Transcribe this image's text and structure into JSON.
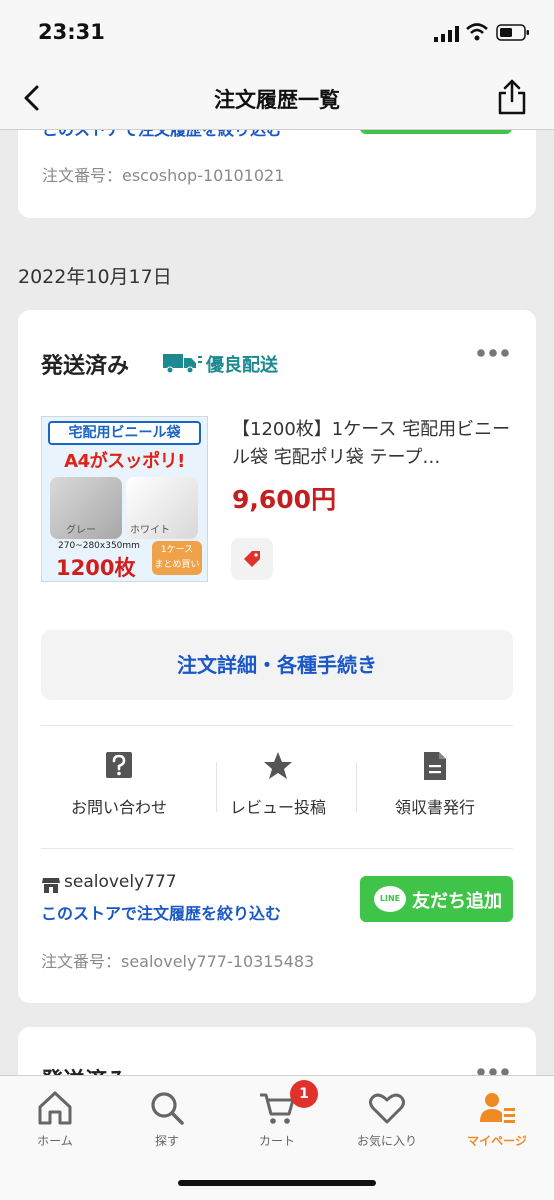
{
  "status_bar": {
    "time": "23:31"
  },
  "nav": {
    "title": "注文履歴一覧",
    "back_icon": "chevron-left-icon",
    "share_icon": "share-icon"
  },
  "prev_order": {
    "store_filter_partial": "このストアで注文履歴を絞り込む",
    "order_number": "注文番号：escoshop-10101021"
  },
  "date_header": "2022年10月17日",
  "order": {
    "status": "発送済み",
    "badge": "優良配送",
    "item": {
      "thumb_title": "宅配用ビニール袋",
      "thumb_sub": "A4がスッポリ!",
      "thumb_grey": "グレー",
      "thumb_white": "ホワイト",
      "thumb_size": "270~280x350mm",
      "thumb_count": "1200枚",
      "thumb_badge_1": "1ケース",
      "thumb_badge_2": "まとめ買い",
      "name": "【1200枚】1ケース 宅配用ビニール袋 宅配ポリ袋 テープ…",
      "price": "9,600円"
    },
    "detail_button": "注文詳細・各種手続き",
    "actions": [
      {
        "label": "お問い合わせ",
        "icon": "question-icon"
      },
      {
        "label": "レビュー投稿",
        "icon": "star-icon"
      },
      {
        "label": "領収書発行",
        "icon": "document-icon"
      }
    ],
    "store_name": "sealovely777",
    "store_filter": "このストアで注文履歴を絞り込む",
    "line_button": "友だち追加",
    "line_logo": "LINE",
    "order_number": "注文番号：sealovely777-10315483"
  },
  "next_order": {
    "status_partial": "発送済み"
  },
  "tabbar": {
    "tabs": [
      {
        "label": "ホーム",
        "icon": "home-icon"
      },
      {
        "label": "探す",
        "icon": "search-icon"
      },
      {
        "label": "カート",
        "icon": "cart-icon"
      },
      {
        "label": "お気に入り",
        "icon": "heart-icon"
      },
      {
        "label": "マイページ",
        "icon": "mypage-icon"
      }
    ],
    "cart_count": "1",
    "active_color": "#f08a24"
  },
  "colors": {
    "link_blue": "#1a57c7",
    "price_red": "#c31f1f",
    "line_green": "#3fc348",
    "premium_teal": "#1c8a90"
  }
}
